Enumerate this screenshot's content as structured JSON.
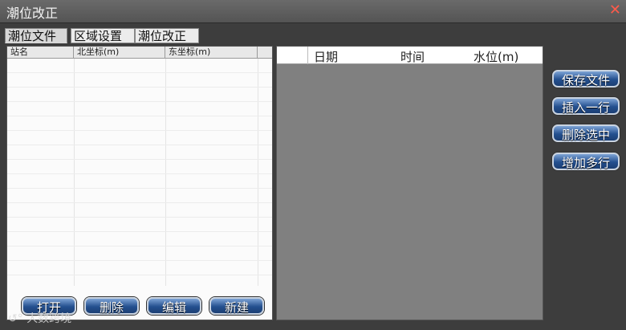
{
  "window": {
    "title": "潮位改正",
    "close_icon": "close-icon"
  },
  "tabs": [
    {
      "label": "潮位文件",
      "active": true
    },
    {
      "label": "区域设置",
      "active": false
    },
    {
      "label": "潮位改正",
      "active": false
    }
  ],
  "station_table": {
    "columns": [
      "站名",
      "北坐标(m)",
      "东坐标(m)"
    ]
  },
  "left_buttons": [
    "打开",
    "删除",
    "编辑",
    "新建"
  ],
  "tide_table": {
    "columns": [
      "日期",
      "时间",
      "水位(m)"
    ]
  },
  "right_buttons": [
    "保存文件",
    "插入一行",
    "删除选中",
    "增加多行"
  ],
  "watermark": "大数跨境"
}
